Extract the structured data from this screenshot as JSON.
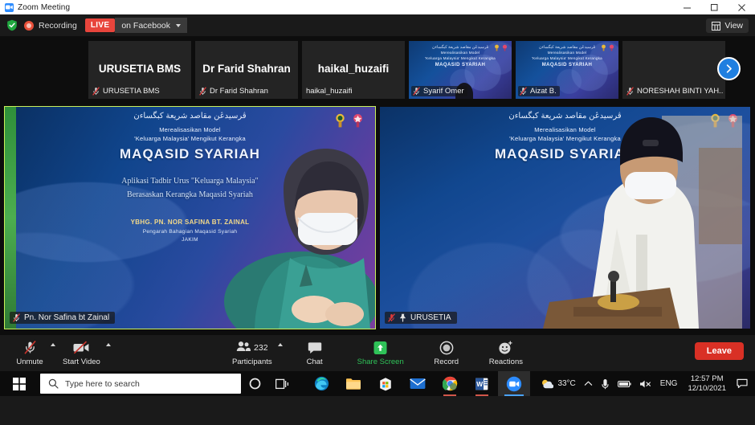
{
  "window": {
    "title": "Zoom Meeting",
    "app_icon": "zoom-camera-icon",
    "controls": {
      "minimize": "minimize-icon",
      "maximize": "maximize-icon",
      "close": "close-icon"
    }
  },
  "status_bar": {
    "encryption_icon": "green-shield-icon",
    "recording_icon": "recording-dot-icon",
    "recording_label": "Recording",
    "live_badge": "LIVE",
    "live_target": "on Facebook",
    "live_dropdown_icon": "caret-down-icon",
    "view_button": {
      "label": "View",
      "icon": "grid-view-icon"
    }
  },
  "thumbnails": {
    "next_button_icon": "chevron-right-icon",
    "items": [
      {
        "center_name": "URUSETIA BMS",
        "label": "URUSETIA BMS",
        "muted": true,
        "has_video": false,
        "label_boxed": false
      },
      {
        "center_name": "Dr Farid Shahran",
        "label": "Dr Farid Shahran",
        "muted": true,
        "has_video": false,
        "label_boxed": false
      },
      {
        "center_name": "haikal_huzaifi",
        "label": "haikal_huzaifi",
        "muted": false,
        "has_video": false,
        "label_boxed": false
      },
      {
        "center_name": "",
        "label": "Syarif Omer",
        "muted": true,
        "has_video": true,
        "label_boxed": true
      },
      {
        "center_name": "",
        "label": "Aizat B.",
        "muted": true,
        "has_video": true,
        "label_boxed": true
      },
      {
        "center_name": "",
        "label": "NORESHAH BINTI YAH...",
        "muted": true,
        "has_video": false,
        "label_boxed": false
      }
    ]
  },
  "video_tiles": [
    {
      "label": "Pn. Nor Safina bt Zainal",
      "muted": true,
      "pinned": false,
      "active_speaker": true,
      "background": {
        "jawi": "ﭬﺮﺳﻴﺪڠن ﻣﻘﺎﺻﺪ ﺷﺮﻳﻌﺔ ﻛﺒﮕﺴﺎءن",
        "line1": "Merealisasikan Model",
        "line2": "'Keluarga Malaysia' Mengikut Kerangka",
        "title": "MAQASID SYARIAH",
        "sub1": "Aplikasi Tadbir Urus \"Keluarga Malaysia\"",
        "sub2": "Berasaskan Kerangka Maqasid Syariah",
        "speaker_name": "YBHG. PN. NOR SAFINA BT. ZAINAL",
        "speaker_role": "Pengarah Bahagian Maqasid Syariah",
        "speaker_org": "JAKIM"
      }
    },
    {
      "label": "URUSETIA",
      "muted": true,
      "pinned": true,
      "active_speaker": false,
      "background": {
        "jawi": "ﭬﺮﺳﻴﺪڠن ﻣﻘﺎﺻﺪ ﺷﺮﻳﻌﺔ ﻛﺒﮕﺴﺎءن",
        "line1": "Merealisasikan Model",
        "line2": "'Keluarga Malaysia' Mengikut Kerangka",
        "title": "MAQASID SYARIAH",
        "sub1": "",
        "sub2": "",
        "speaker_name": "",
        "speaker_role": "",
        "speaker_org": ""
      }
    }
  ],
  "toolbar": {
    "mute": {
      "label": "Unmute",
      "icon": "microphone-muted-icon"
    },
    "video": {
      "label": "Start Video",
      "icon": "camera-off-icon"
    },
    "participants": {
      "label": "Participants",
      "count": "232",
      "icon": "participants-icon"
    },
    "chat": {
      "label": "Chat",
      "icon": "chat-bubble-icon"
    },
    "share": {
      "label": "Share Screen",
      "icon": "share-screen-icon",
      "color": "#2fc258"
    },
    "record": {
      "label": "Record",
      "icon": "record-circle-icon"
    },
    "reactions": {
      "label": "Reactions",
      "icon": "reactions-smiley-icon"
    },
    "leave": {
      "label": "Leave",
      "color": "#d93025"
    }
  },
  "taskbar": {
    "start_icon": "windows-start-icon",
    "search_placeholder": "Type here to search",
    "search_icon": "magnifier-icon",
    "cortana_icon": "cortana-circle-icon",
    "taskview_icon": "task-view-icon",
    "apps": [
      {
        "name": "microsoft-edge-icon",
        "state": "idle"
      },
      {
        "name": "file-explorer-icon",
        "state": "idle"
      },
      {
        "name": "microsoft-store-icon",
        "state": "idle"
      },
      {
        "name": "mail-icon",
        "state": "idle"
      },
      {
        "name": "google-chrome-icon",
        "state": "open"
      },
      {
        "name": "microsoft-word-icon",
        "state": "open"
      },
      {
        "name": "zoom-icon",
        "state": "active"
      }
    ],
    "tray": {
      "weather_icon": "partly-cloudy-icon",
      "temperature": "33°C",
      "chevron_icon": "show-hidden-icons-icon",
      "onedrive_icon": "onedrive-icon",
      "battery_icon": "battery-icon",
      "volume_icon": "volume-muted-icon",
      "language": "ENG",
      "time": "12:57 PM",
      "date": "12/10/2021",
      "notifications_icon": "notification-icon"
    }
  }
}
